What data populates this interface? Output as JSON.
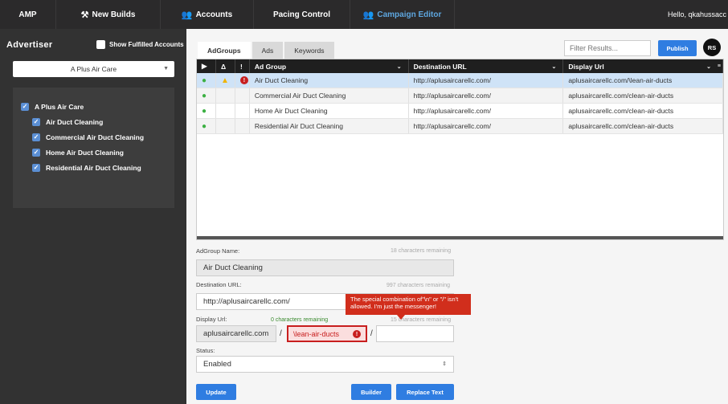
{
  "nav": {
    "items": [
      {
        "label": "AMP",
        "icon": ""
      },
      {
        "label": "New Builds",
        "icon": "⚒"
      },
      {
        "label": "Accounts",
        "icon": "👥"
      },
      {
        "label": "Pacing Control",
        "icon": ""
      },
      {
        "label": "Campaign Editor",
        "icon": "👥"
      }
    ],
    "hello": "Hello, qkahussacc"
  },
  "sidebar": {
    "title": "Advertiser",
    "show_fulfilled": "Show Fulfilled Accounts",
    "advertiser_selected": "A Plus Air Care",
    "tree": [
      {
        "label": "A Plus Air Care",
        "level": "root"
      },
      {
        "label": "Air Duct Cleaning",
        "level": "child"
      },
      {
        "label": "Commercial Air Duct Cleaning",
        "level": "child"
      },
      {
        "label": "Home Air Duct Cleaning",
        "level": "child"
      },
      {
        "label": "Residential Air Duct Cleaning",
        "level": "child"
      }
    ]
  },
  "tabs": [
    "AdGroups",
    "Ads",
    "Keywords"
  ],
  "filter_placeholder": "Filter Results...",
  "publish_label": "Publish",
  "avatar": "RS",
  "grid": {
    "headers": [
      "▶",
      "Δ",
      "!",
      "Ad Group",
      "Destination URL",
      "Display Url"
    ],
    "rows": [
      {
        "ad_group": "Air Duct Cleaning",
        "destination": "http://aplusaircarellc.com/",
        "display": "aplusaircarellc.com/\\lean-air-ducts"
      },
      {
        "ad_group": "Commercial Air Duct Cleaning",
        "destination": "http://aplusaircarellc.com/",
        "display": "aplusaircarellc.com/clean-air-ducts"
      },
      {
        "ad_group": "Home Air Duct Cleaning",
        "destination": "http://aplusaircarellc.com/",
        "display": "aplusaircarellc.com/clean-air-ducts"
      },
      {
        "ad_group": "Residential Air Duct Cleaning",
        "destination": "http://aplusaircarellc.com/",
        "display": "aplusaircarellc.com/clean-air-ducts"
      }
    ]
  },
  "form": {
    "adgroup_label": "AdGroup Name:",
    "adgroup_remaining": "18 characters remaining",
    "adgroup_value": "Air Duct Cleaning",
    "dest_label": "Destination URL:",
    "dest_remaining": "997 characters remaining",
    "dest_value": "http://aplusaircarellc.com/",
    "display_label": "Display Url:",
    "display_remaining_1": "0 characters remaining",
    "display_remaining_2": "15 characters remaining",
    "display_base": "aplusaircarellc.com",
    "display_path1": "\\lean-air-ducts",
    "display_path2": "",
    "tooltip": "The special combination of\"\\n\" or \"/\" isn't allowed. I'm just the messenger!",
    "status_label": "Status:",
    "status_value": "Enabled",
    "update_label": "Update",
    "builder_label": "Builder",
    "replace_label": "Replace Text"
  }
}
